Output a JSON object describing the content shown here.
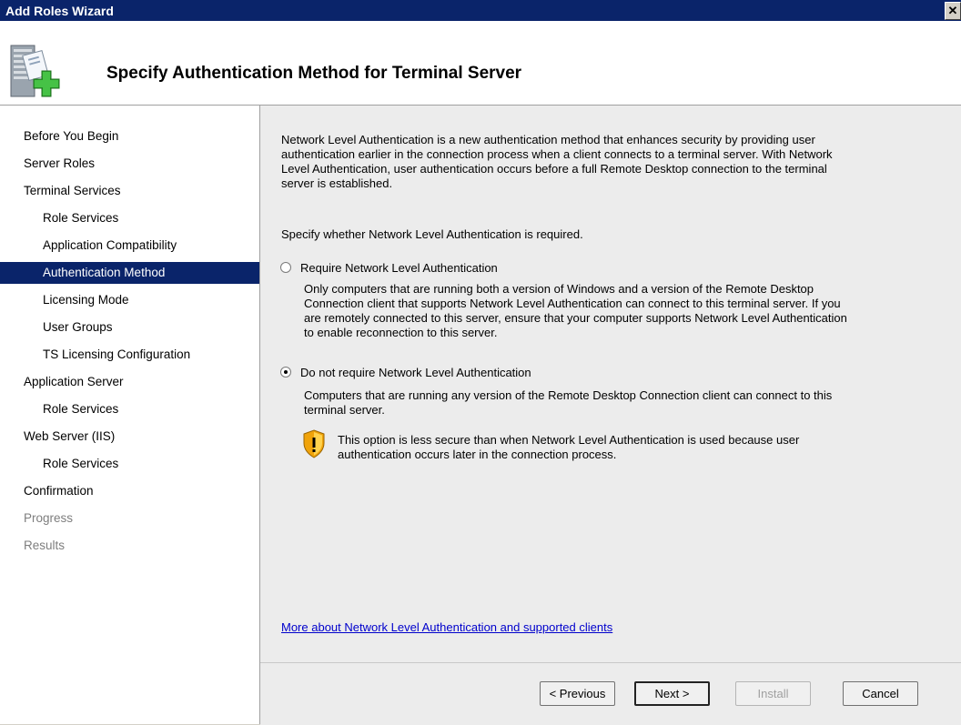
{
  "window": {
    "title": "Add Roles Wizard",
    "close_glyph": "✕"
  },
  "header": {
    "title": "Specify Authentication Method for Terminal Server",
    "icon": "server-add-icon"
  },
  "nav": {
    "items": [
      {
        "label": "Before You Begin",
        "level": 1
      },
      {
        "label": "Server Roles",
        "level": 1
      },
      {
        "label": "Terminal Services",
        "level": 1
      },
      {
        "label": "Role Services",
        "level": 2
      },
      {
        "label": "Application Compatibility",
        "level": 2
      },
      {
        "label": "Authentication Method",
        "level": 2,
        "selected": true
      },
      {
        "label": "Licensing Mode",
        "level": 2
      },
      {
        "label": "User Groups",
        "level": 2
      },
      {
        "label": "TS Licensing Configuration",
        "level": 2
      },
      {
        "label": "Application Server",
        "level": 1
      },
      {
        "label": "Role Services",
        "level": 2
      },
      {
        "label": "Web Server (IIS)",
        "level": 1
      },
      {
        "label": "Role Services",
        "level": 2
      },
      {
        "label": "Confirmation",
        "level": 1
      },
      {
        "label": "Progress",
        "level": 1,
        "disabled": true
      },
      {
        "label": "Results",
        "level": 1,
        "disabled": true
      }
    ]
  },
  "content": {
    "intro_lines": [
      "Network Level Authentication is a new authentication method that enhances security by providing user",
      "authentication earlier in the connection process when a client connects to a terminal server. With Network",
      "Level Authentication, user authentication occurs before a full Remote Desktop connection to the terminal",
      "server is established."
    ],
    "prompt": "Specify whether Network Level Authentication is required.",
    "option1": {
      "label": "Require Network Level Authentication",
      "checked": false,
      "desc_lines": [
        "Only computers that are running both a version of Windows and a version of the Remote Desktop",
        "Connection client that supports Network Level Authentication can connect to this terminal server. If you",
        "are remotely connected to this server, ensure that your computer supports Network Level Authentication",
        "to enable reconnection to this server."
      ]
    },
    "option2": {
      "label": "Do not require Network Level Authentication",
      "checked": true,
      "desc_lines": [
        "Computers that are running any version of the Remote Desktop Connection client can connect to this",
        "terminal server."
      ],
      "warning_lines": [
        "This option is less secure than when Network Level Authentication is used because user",
        "authentication occurs later in the connection process."
      ]
    },
    "link": "More about Network Level Authentication and supported clients"
  },
  "footer": {
    "previous": "< Previous",
    "next": "Next >",
    "install": "Install",
    "cancel": "Cancel"
  }
}
